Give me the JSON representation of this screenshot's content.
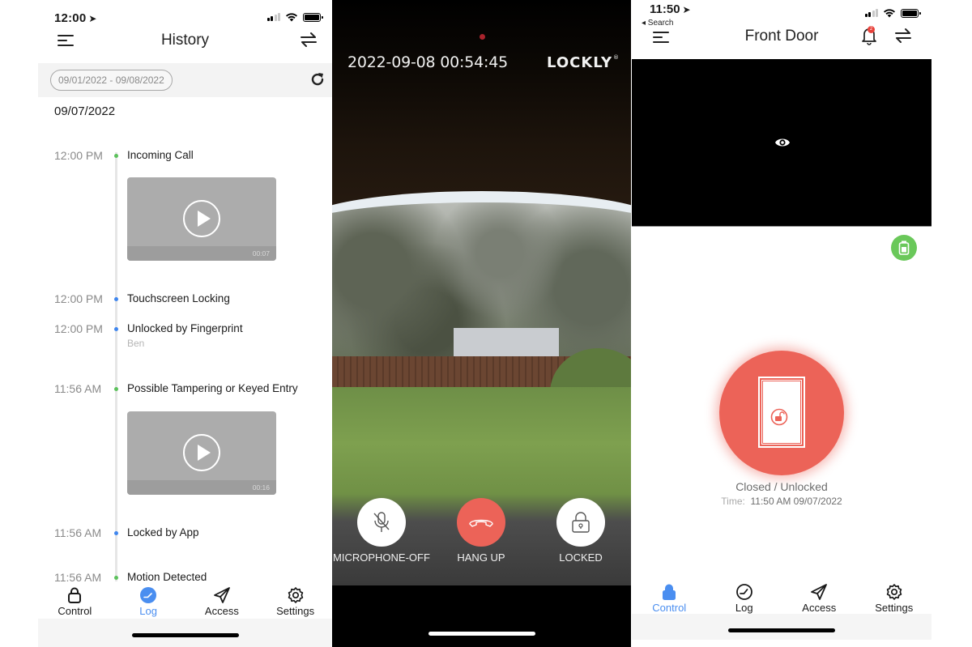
{
  "history_screen": {
    "status_time": "12:00",
    "title": "History",
    "date_range": "09/01/2022 - 09/08/2022",
    "day": "09/07/2022",
    "events": [
      {
        "time": "12:00 PM",
        "title": "Incoming Call",
        "dot_color": "#5cc15c",
        "video_duration": "00:07"
      },
      {
        "time": "12:00 PM",
        "title": "Touchscreen Locking",
        "dot_color": "#3f86ee"
      },
      {
        "time": "12:00 PM",
        "title": "Unlocked by Fingerprint",
        "subtitle": "Ben",
        "dot_color": "#3f86ee"
      },
      {
        "time": "11:56 AM",
        "title": "Possible Tampering or Keyed Entry",
        "dot_color": "#5cc15c",
        "video_duration": "00:16"
      },
      {
        "time": "11:56 AM",
        "title": "Locked by App",
        "dot_color": "#3f86ee"
      },
      {
        "time": "11:56 AM",
        "title": "Motion Detected",
        "dot_color": "#5cc15c"
      }
    ],
    "tabs": [
      {
        "label": "Control",
        "icon": "lock-icon",
        "active": false
      },
      {
        "label": "Log",
        "icon": "clock-icon",
        "active": true
      },
      {
        "label": "Access",
        "icon": "send-icon",
        "active": false
      },
      {
        "label": "Settings",
        "icon": "gear-icon",
        "active": false
      }
    ]
  },
  "call_screen": {
    "timestamp": "2022-09-08  00:54:45",
    "brand": "LOCKLY",
    "brand_mark": "®",
    "buttons": [
      {
        "label": "MICROPHONE-OFF",
        "icon": "microphone-off-icon"
      },
      {
        "label": "HANG UP",
        "icon": "hang-up-icon"
      },
      {
        "label": "LOCKED",
        "icon": "lock-icon"
      }
    ]
  },
  "control_screen": {
    "status_time": "11:50",
    "back_label": "◂ Search",
    "title": "Front Door",
    "notification_count": "2",
    "lock_state": "Closed / Unlocked",
    "time_label": "Time:",
    "time_value": "11:50 AM 09/07/2022",
    "tabs": [
      {
        "label": "Control",
        "icon": "lock-icon",
        "active": true
      },
      {
        "label": "Log",
        "icon": "clock-icon",
        "active": false
      },
      {
        "label": "Access",
        "icon": "send-icon",
        "active": false
      },
      {
        "label": "Settings",
        "icon": "gear-icon",
        "active": false
      }
    ]
  },
  "colors": {
    "accent_blue": "#4a8ef0",
    "alert_red": "#ec6358",
    "battery_green": "#6ac85a"
  }
}
